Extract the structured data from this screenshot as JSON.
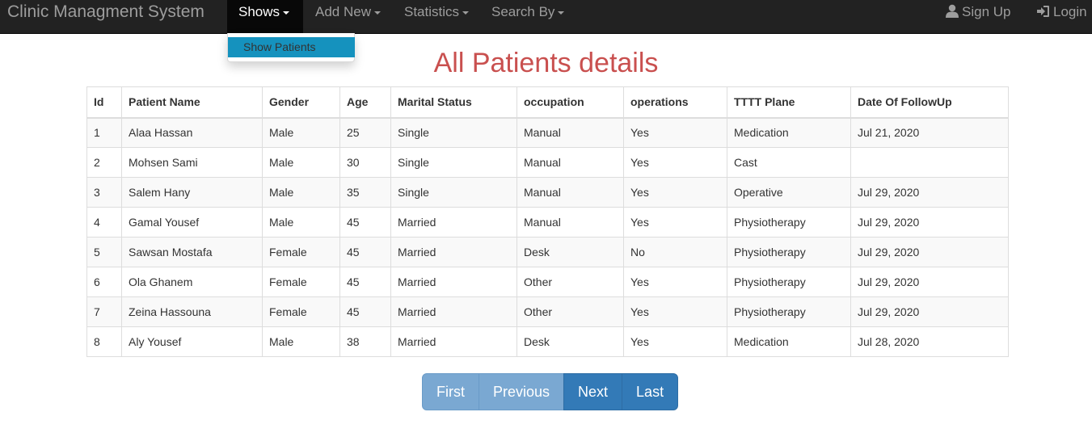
{
  "navbar": {
    "brand": "Clinic Managment System",
    "menus": [
      {
        "label": "Shows",
        "active": true
      },
      {
        "label": "Add New",
        "active": false
      },
      {
        "label": "Statistics",
        "active": false
      },
      {
        "label": "Search By",
        "active": false
      }
    ],
    "signup": {
      "label": "Sign Up",
      "icon": "user-icon"
    },
    "login": {
      "label": "Login",
      "icon": "login-icon"
    }
  },
  "dropdown": {
    "items": [
      {
        "label": "Show Patients"
      }
    ]
  },
  "title": "All Patients details",
  "table": {
    "columns": [
      "Id",
      "Patient Name",
      "Gender",
      "Age",
      "Marital Status",
      "occupation",
      "operations",
      "TTTT Plane",
      "Date Of FollowUp"
    ],
    "rows": [
      [
        "1",
        "Alaa Hassan",
        "Male",
        "25",
        "Single",
        "Manual",
        "Yes",
        "Medication",
        "Jul 21, 2020"
      ],
      [
        "2",
        "Mohsen Sami",
        "Male",
        "30",
        "Single",
        "Manual",
        "Yes",
        "Cast",
        ""
      ],
      [
        "3",
        "Salem Hany",
        "Male",
        "35",
        "Single",
        "Manual",
        "Yes",
        "Operative",
        "Jul 29, 2020"
      ],
      [
        "4",
        "Gamal Yousef",
        "Male",
        "45",
        "Married",
        "Manual",
        "Yes",
        "Physiotherapy",
        "Jul 29, 2020"
      ],
      [
        "5",
        "Sawsan Mostafa",
        "Female",
        "45",
        "Married",
        "Desk",
        "No",
        "Physiotherapy",
        "Jul 29, 2020"
      ],
      [
        "6",
        "Ola Ghanem",
        "Female",
        "45",
        "Married",
        "Other",
        "Yes",
        "Physiotherapy",
        "Jul 29, 2020"
      ],
      [
        "7",
        "Zeina Hassouna",
        "Female",
        "45",
        "Married",
        "Other",
        "Yes",
        "Physiotherapy",
        "Jul 29, 2020"
      ],
      [
        "8",
        "Aly Yousef",
        "Male",
        "38",
        "Married",
        "Desk",
        "Yes",
        "Medication",
        "Jul 28, 2020"
      ]
    ]
  },
  "pagination": {
    "first": "First",
    "previous": "Previous",
    "next": "Next",
    "last": "Last"
  },
  "colors": {
    "navbar": "#222222",
    "title": "#c9504f",
    "dropdown_highlight": "#1592be",
    "primary": "#337ab7"
  }
}
